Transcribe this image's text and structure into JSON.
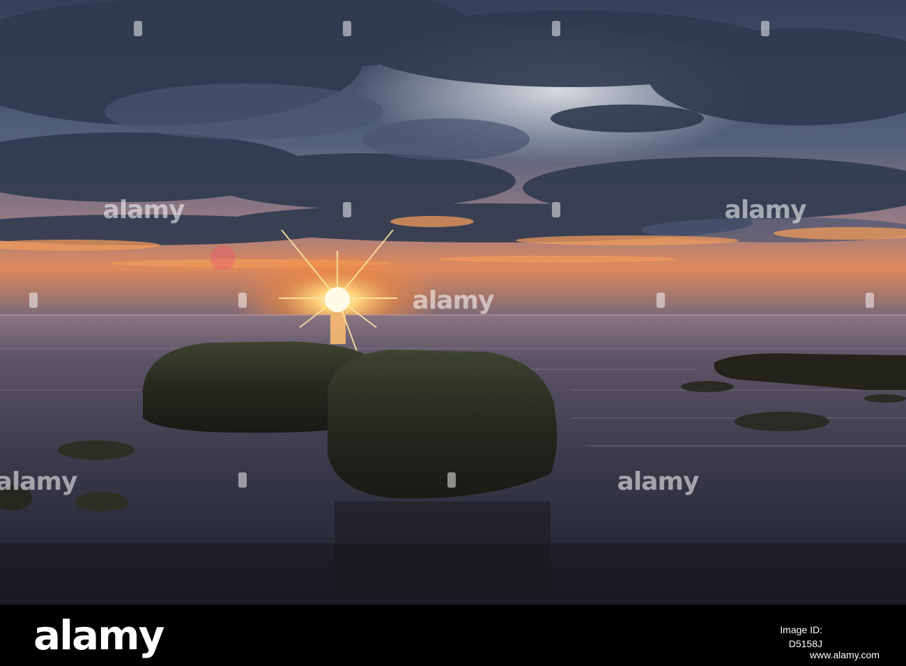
{
  "watermark": {
    "text": "alamy"
  },
  "footer": {
    "logo": "alamy",
    "image_id_label": "Image ID:",
    "image_id": "D5158J",
    "url": "www.alamy.com"
  },
  "colors": {
    "sky_dark": "#2e3a52",
    "sky_light": "#d9dde4",
    "sunset_orange": "#f28a3a",
    "sun": "#fff6c8",
    "water": "#2b2c38",
    "rock": "#2a2a20",
    "bar": "#000000"
  }
}
